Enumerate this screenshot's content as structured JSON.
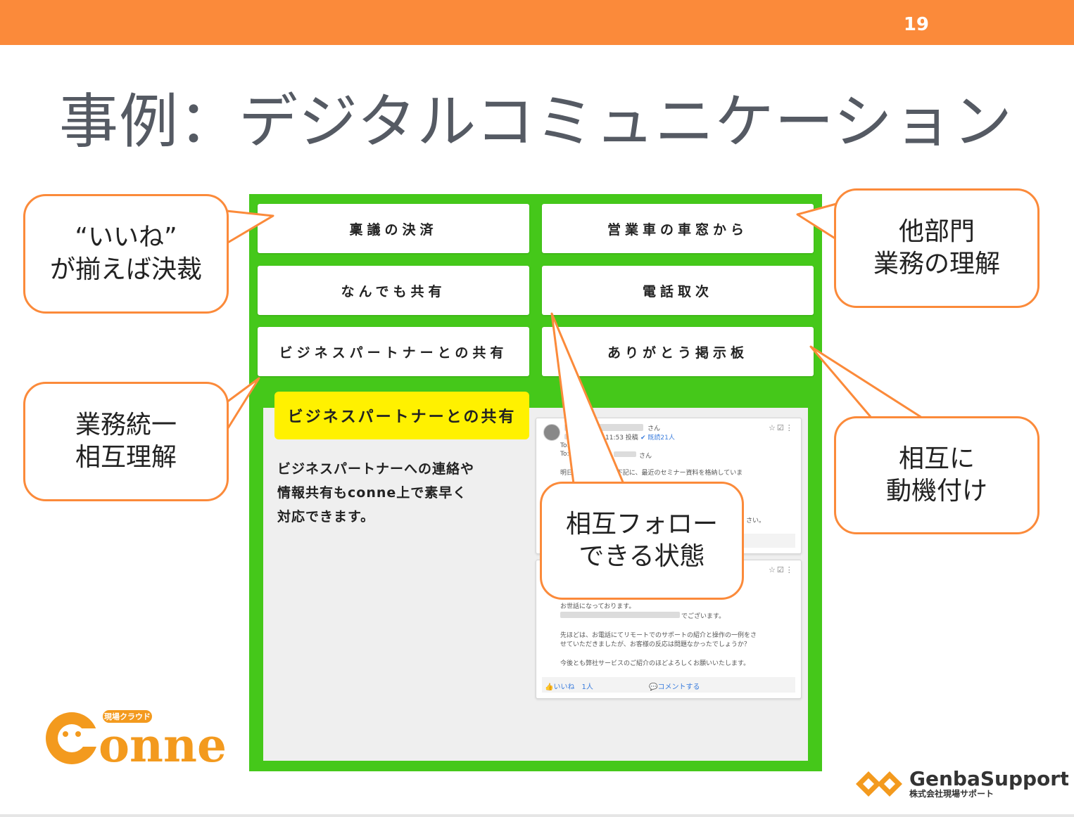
{
  "page_number": "19",
  "title": "事例：デジタルコミュニケーション",
  "menu": {
    "items": [
      {
        "label": "稟議の決済"
      },
      {
        "label": "営業車の車窓から"
      },
      {
        "label": "なんでも共有"
      },
      {
        "label": "電話取次"
      },
      {
        "label": "ビジネスパートナーとの共有"
      },
      {
        "label": "ありがとう掲示板"
      }
    ]
  },
  "feature": {
    "heading": "ビジネスパートナーとの共有",
    "description_lines": [
      "ビジネスパートナーへの連絡や",
      "情報共有もconne上で素早く",
      "対応できます。"
    ]
  },
  "post1": {
    "san": "さん",
    "time_fragment": "11:53 投稿",
    "read_count": "✔ 既読21人",
    "to_label_1": "To:",
    "to_label_2": "To:",
    "to_san": "さん",
    "body_prefix": "明日",
    "body_fragment": "して下記に、最近のセミナー資料を格納していま",
    "body_tail": "さい。",
    "icons": "☆☑⋮"
  },
  "post2": {
    "icons": "☆☑⋮",
    "line1": "お世話になっております。",
    "line2": "でございます。",
    "line3": "先ほどは、お電話にてリモートでのサポートの紹介と操作の一例をさ",
    "line4": "せていただきましたが、お客様の反応は問題なかったでしょうか？",
    "line5": "今後とも弊社サービスのご紹介のほどよろしくお願いいたします。",
    "like": "👍いいね　1人",
    "comment": "💬コメントする"
  },
  "callouts": {
    "likes": {
      "line1": "“いいね”",
      "line2": "が揃えば決裁"
    },
    "other_dept": {
      "line1": "他部門",
      "line2": "業務の理解"
    },
    "unify": {
      "line1": "業務統一",
      "line2": "相互理解"
    },
    "motivate": {
      "line1": "相互に",
      "line2": "動機付け"
    },
    "follow": {
      "line1": "相互フォロー",
      "line2": "できる状態"
    }
  },
  "logos": {
    "conne_sub": "現場クラウド",
    "conne_text": "onne",
    "genba_name": "GenbaSupport",
    "genba_sub": "株式会社現場サポート"
  },
  "colors": {
    "orange": "#fb8a3a",
    "green": "#45c81a",
    "yellow": "#fff100",
    "title_gray": "#555a63"
  }
}
